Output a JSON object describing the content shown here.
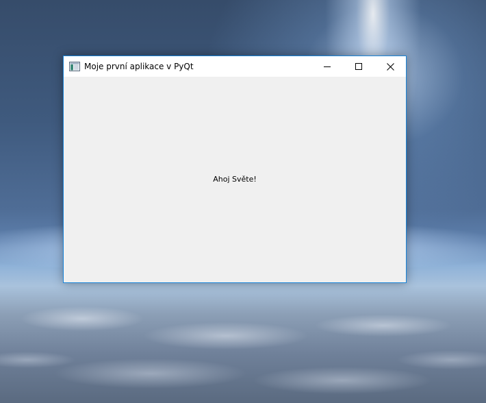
{
  "desktop": {
    "wallpaper": "space-earth-horizon"
  },
  "window": {
    "title": "Moje první aplikace v PyQt",
    "icon": "window-app-icon",
    "accent_color": "#1883d7",
    "controls": {
      "minimize_icon": "minimize-icon",
      "maximize_icon": "maximize-icon",
      "close_icon": "close-icon"
    },
    "content": {
      "label": "Ahoj Světe!"
    }
  }
}
